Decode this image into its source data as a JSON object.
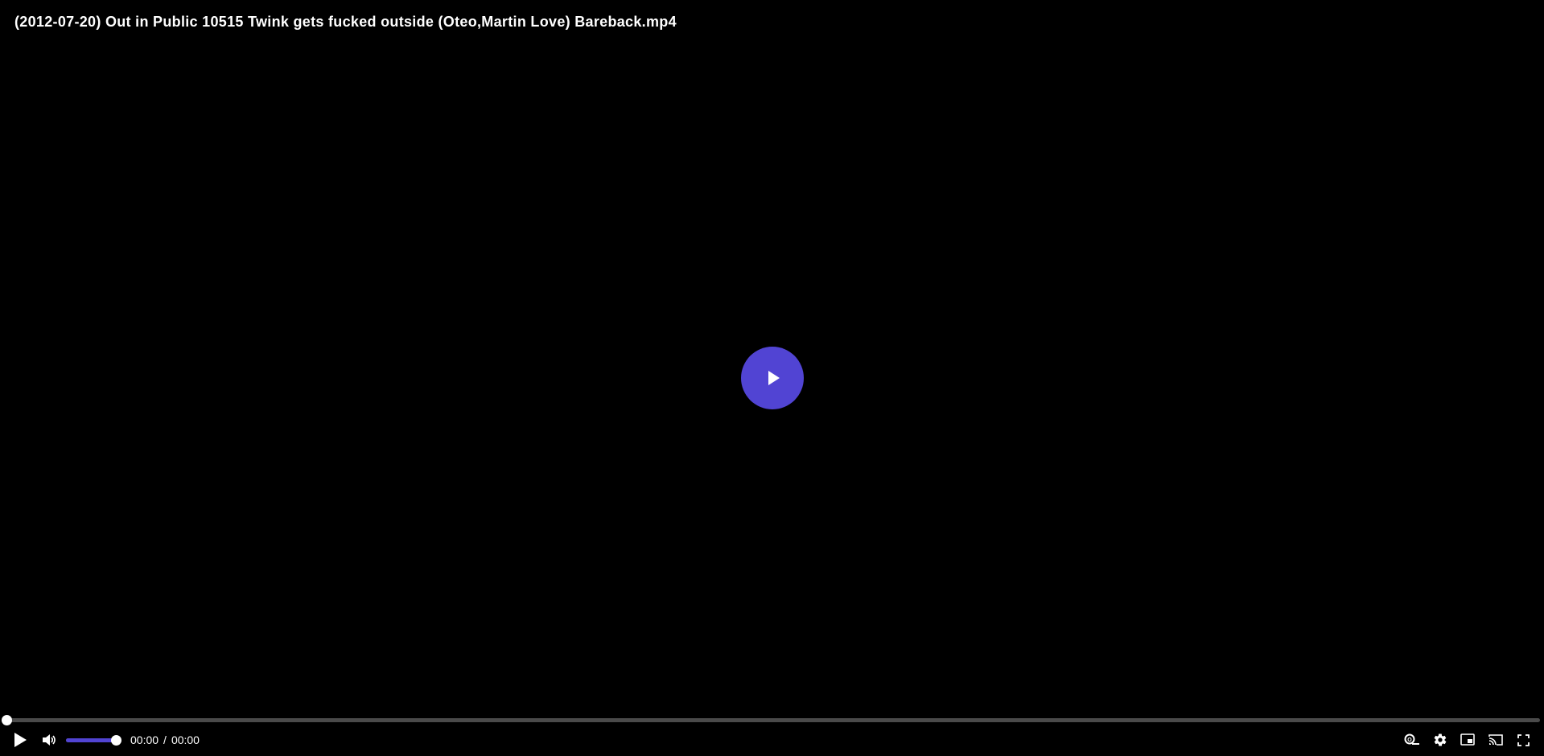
{
  "video": {
    "title": "(2012-07-20) Out in Public 10515 Twink gets fucked outside (Oteo,Martin Love) Bareback.mp4"
  },
  "playback": {
    "current_time": "00:00",
    "separator": "/",
    "duration": "00:00",
    "progress": 0,
    "volume": 1.0
  },
  "icons": {
    "big_play": "play-icon",
    "play": "play-icon",
    "volume": "volume-icon",
    "captions": "subtitles-icon",
    "settings": "gear-icon",
    "pip": "picture-in-picture-icon",
    "cast": "cast-icon",
    "fullscreen": "fullscreen-icon"
  },
  "colors": {
    "accent": "#5144d3",
    "track": "#4a4a4a",
    "background": "#000000"
  }
}
